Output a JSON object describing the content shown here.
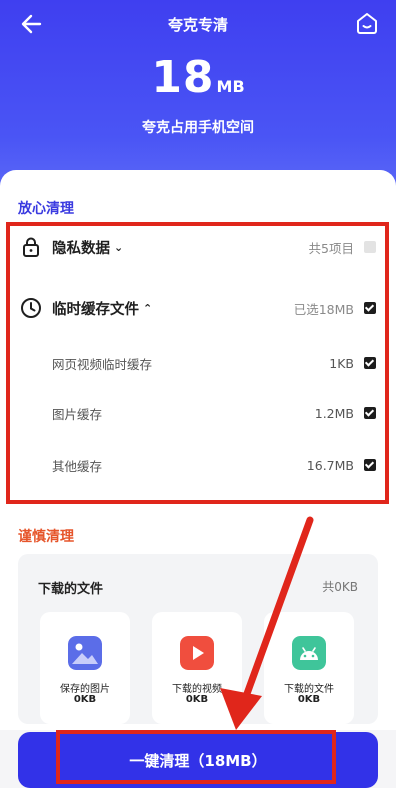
{
  "header": {
    "title": "夸克专清",
    "size_value": "18",
    "size_unit": "MB",
    "subtitle": "夸克占用手机空间"
  },
  "safe_clean": {
    "title": "放心清理",
    "privacy": {
      "label": "隐私数据",
      "value": "共5项目",
      "checked": false
    },
    "temp_cache": {
      "label": "临时缓存文件",
      "value": "已选18MB",
      "checked": true,
      "items": [
        {
          "label": "网页视频临时缓存",
          "value": "1KB",
          "checked": true
        },
        {
          "label": "图片缓存",
          "value": "1.2MB",
          "checked": true
        },
        {
          "label": "其他缓存",
          "value": "16.7MB",
          "checked": true
        }
      ]
    }
  },
  "careful_clean": {
    "title": "谨慎清理",
    "downloads": {
      "title": "下载的文件",
      "total": "共0KB",
      "tiles": [
        {
          "label": "保存的图片",
          "size": "0KB",
          "icon": "image-icon",
          "color": "#5b6de8"
        },
        {
          "label": "下载的视频",
          "size": "0KB",
          "icon": "play-icon",
          "color": "#f04e3e"
        },
        {
          "label": "下载的文件",
          "size": "0KB",
          "icon": "android-icon",
          "color": "#3fc59a"
        }
      ]
    }
  },
  "clean_button": {
    "label": "一键清理（18MB）"
  },
  "colors": {
    "accent": "#3232e8",
    "annotation": "#e0261b"
  }
}
